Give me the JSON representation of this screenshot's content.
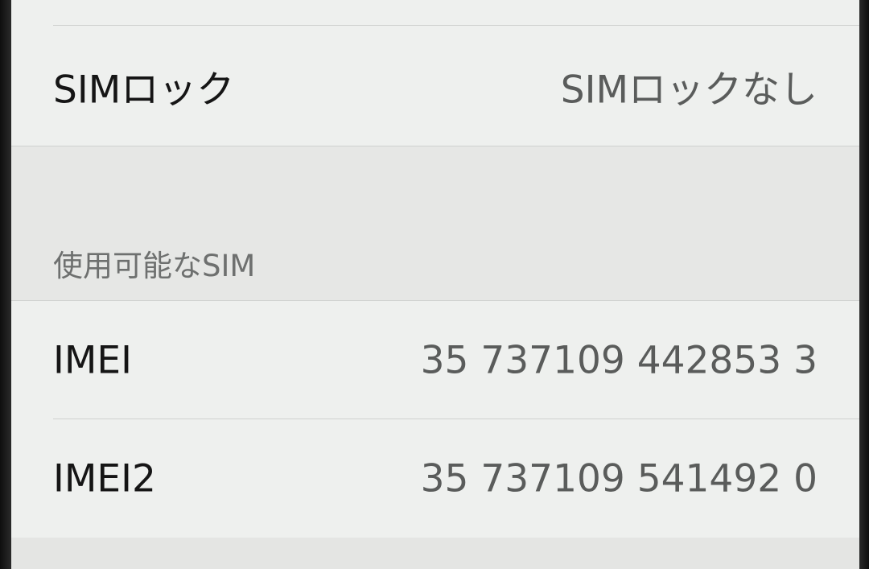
{
  "sim_lock": {
    "label": "SIMロック",
    "value": "SIMロックなし"
  },
  "available_sim": {
    "header": "使用可能なSIM"
  },
  "imei": {
    "label": "IMEI",
    "value": "35 737109 442853 3"
  },
  "imei2": {
    "label": "IMEI2",
    "value": "35 737109 541492 0"
  }
}
